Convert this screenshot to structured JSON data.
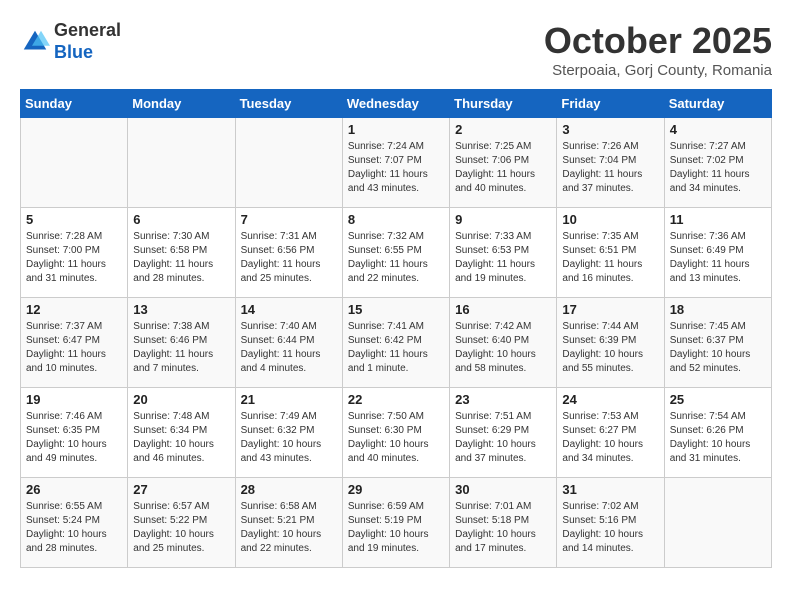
{
  "header": {
    "logo_general": "General",
    "logo_blue": "Blue",
    "month_title": "October 2025",
    "subtitle": "Sterpoaia, Gorj County, Romania"
  },
  "days_of_week": [
    "Sunday",
    "Monday",
    "Tuesday",
    "Wednesday",
    "Thursday",
    "Friday",
    "Saturday"
  ],
  "weeks": [
    [
      {
        "day": "",
        "info": ""
      },
      {
        "day": "",
        "info": ""
      },
      {
        "day": "",
        "info": ""
      },
      {
        "day": "1",
        "info": "Sunrise: 7:24 AM\nSunset: 7:07 PM\nDaylight: 11 hours and 43 minutes."
      },
      {
        "day": "2",
        "info": "Sunrise: 7:25 AM\nSunset: 7:06 PM\nDaylight: 11 hours and 40 minutes."
      },
      {
        "day": "3",
        "info": "Sunrise: 7:26 AM\nSunset: 7:04 PM\nDaylight: 11 hours and 37 minutes."
      },
      {
        "day": "4",
        "info": "Sunrise: 7:27 AM\nSunset: 7:02 PM\nDaylight: 11 hours and 34 minutes."
      }
    ],
    [
      {
        "day": "5",
        "info": "Sunrise: 7:28 AM\nSunset: 7:00 PM\nDaylight: 11 hours and 31 minutes."
      },
      {
        "day": "6",
        "info": "Sunrise: 7:30 AM\nSunset: 6:58 PM\nDaylight: 11 hours and 28 minutes."
      },
      {
        "day": "7",
        "info": "Sunrise: 7:31 AM\nSunset: 6:56 PM\nDaylight: 11 hours and 25 minutes."
      },
      {
        "day": "8",
        "info": "Sunrise: 7:32 AM\nSunset: 6:55 PM\nDaylight: 11 hours and 22 minutes."
      },
      {
        "day": "9",
        "info": "Sunrise: 7:33 AM\nSunset: 6:53 PM\nDaylight: 11 hours and 19 minutes."
      },
      {
        "day": "10",
        "info": "Sunrise: 7:35 AM\nSunset: 6:51 PM\nDaylight: 11 hours and 16 minutes."
      },
      {
        "day": "11",
        "info": "Sunrise: 7:36 AM\nSunset: 6:49 PM\nDaylight: 11 hours and 13 minutes."
      }
    ],
    [
      {
        "day": "12",
        "info": "Sunrise: 7:37 AM\nSunset: 6:47 PM\nDaylight: 11 hours and 10 minutes."
      },
      {
        "day": "13",
        "info": "Sunrise: 7:38 AM\nSunset: 6:46 PM\nDaylight: 11 hours and 7 minutes."
      },
      {
        "day": "14",
        "info": "Sunrise: 7:40 AM\nSunset: 6:44 PM\nDaylight: 11 hours and 4 minutes."
      },
      {
        "day": "15",
        "info": "Sunrise: 7:41 AM\nSunset: 6:42 PM\nDaylight: 11 hours and 1 minute."
      },
      {
        "day": "16",
        "info": "Sunrise: 7:42 AM\nSunset: 6:40 PM\nDaylight: 10 hours and 58 minutes."
      },
      {
        "day": "17",
        "info": "Sunrise: 7:44 AM\nSunset: 6:39 PM\nDaylight: 10 hours and 55 minutes."
      },
      {
        "day": "18",
        "info": "Sunrise: 7:45 AM\nSunset: 6:37 PM\nDaylight: 10 hours and 52 minutes."
      }
    ],
    [
      {
        "day": "19",
        "info": "Sunrise: 7:46 AM\nSunset: 6:35 PM\nDaylight: 10 hours and 49 minutes."
      },
      {
        "day": "20",
        "info": "Sunrise: 7:48 AM\nSunset: 6:34 PM\nDaylight: 10 hours and 46 minutes."
      },
      {
        "day": "21",
        "info": "Sunrise: 7:49 AM\nSunset: 6:32 PM\nDaylight: 10 hours and 43 minutes."
      },
      {
        "day": "22",
        "info": "Sunrise: 7:50 AM\nSunset: 6:30 PM\nDaylight: 10 hours and 40 minutes."
      },
      {
        "day": "23",
        "info": "Sunrise: 7:51 AM\nSunset: 6:29 PM\nDaylight: 10 hours and 37 minutes."
      },
      {
        "day": "24",
        "info": "Sunrise: 7:53 AM\nSunset: 6:27 PM\nDaylight: 10 hours and 34 minutes."
      },
      {
        "day": "25",
        "info": "Sunrise: 7:54 AM\nSunset: 6:26 PM\nDaylight: 10 hours and 31 minutes."
      }
    ],
    [
      {
        "day": "26",
        "info": "Sunrise: 6:55 AM\nSunset: 5:24 PM\nDaylight: 10 hours and 28 minutes."
      },
      {
        "day": "27",
        "info": "Sunrise: 6:57 AM\nSunset: 5:22 PM\nDaylight: 10 hours and 25 minutes."
      },
      {
        "day": "28",
        "info": "Sunrise: 6:58 AM\nSunset: 5:21 PM\nDaylight: 10 hours and 22 minutes."
      },
      {
        "day": "29",
        "info": "Sunrise: 6:59 AM\nSunset: 5:19 PM\nDaylight: 10 hours and 19 minutes."
      },
      {
        "day": "30",
        "info": "Sunrise: 7:01 AM\nSunset: 5:18 PM\nDaylight: 10 hours and 17 minutes."
      },
      {
        "day": "31",
        "info": "Sunrise: 7:02 AM\nSunset: 5:16 PM\nDaylight: 10 hours and 14 minutes."
      },
      {
        "day": "",
        "info": ""
      }
    ]
  ]
}
